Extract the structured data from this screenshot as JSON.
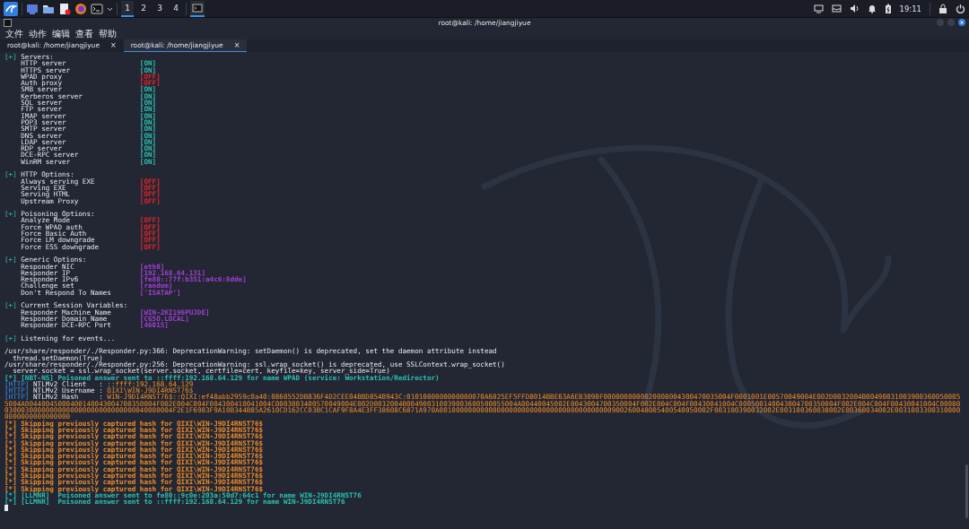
{
  "panel": {
    "workspaces": [
      {
        "label": "1",
        "selected": true
      },
      {
        "label": "2",
        "selected": false
      },
      {
        "label": "3",
        "selected": false
      },
      {
        "label": "4",
        "selected": false
      }
    ],
    "clock": "19:11"
  },
  "window": {
    "title": "root@kali: /home/jiangjiyue",
    "menu": [
      "文件",
      "动作",
      "编辑",
      "查看",
      "帮助"
    ],
    "tabs": [
      {
        "label": "root@kali: /home/jiangjiyue",
        "close": "×",
        "selected": false
      },
      {
        "label": "root@kali: /home/jiangjiyue",
        "close": "×",
        "selected": true
      }
    ]
  },
  "terminal": {
    "lines": [
      {
        "kind": "header",
        "bullet": "[+]",
        "text": "Servers:"
      },
      {
        "kind": "option",
        "label": "HTTP server",
        "value": "[ON]",
        "color": "#2bc0b4"
      },
      {
        "kind": "option",
        "label": "HTTPS server",
        "value": "[ON]",
        "color": "#2bc0b4"
      },
      {
        "kind": "option",
        "label": "WPAD proxy",
        "value": "[OFF]",
        "color": "#e0242a"
      },
      {
        "kind": "option",
        "label": "Auth proxy",
        "value": "[OFF]",
        "color": "#e0242a"
      },
      {
        "kind": "option",
        "label": "SMB server",
        "value": "[ON]",
        "color": "#2bc0b4"
      },
      {
        "kind": "option",
        "label": "Kerberos server",
        "value": "[ON]",
        "color": "#2bc0b4"
      },
      {
        "kind": "option",
        "label": "SQL server",
        "value": "[ON]",
        "color": "#2bc0b4"
      },
      {
        "kind": "option",
        "label": "FTP server",
        "value": "[ON]",
        "color": "#2bc0b4"
      },
      {
        "kind": "option",
        "label": "IMAP server",
        "value": "[ON]",
        "color": "#2bc0b4"
      },
      {
        "kind": "option",
        "label": "POP3 server",
        "value": "[ON]",
        "color": "#2bc0b4"
      },
      {
        "kind": "option",
        "label": "SMTP server",
        "value": "[ON]",
        "color": "#2bc0b4"
      },
      {
        "kind": "option",
        "label": "DNS server",
        "value": "[ON]",
        "color": "#2bc0b4"
      },
      {
        "kind": "option",
        "label": "LDAP server",
        "value": "[ON]",
        "color": "#2bc0b4"
      },
      {
        "kind": "option",
        "label": "RDP server",
        "value": "[ON]",
        "color": "#2bc0b4"
      },
      {
        "kind": "option",
        "label": "DCE-RPC server",
        "value": "[ON]",
        "color": "#2bc0b4"
      },
      {
        "kind": "option",
        "label": "WinRM server",
        "value": "[ON]",
        "color": "#2bc0b4"
      },
      {
        "kind": "blank"
      },
      {
        "kind": "header",
        "bullet": "[+]",
        "text": "HTTP Options:"
      },
      {
        "kind": "option",
        "label": "Always serving EXE",
        "value": "[OFF]",
        "color": "#e0242a"
      },
      {
        "kind": "option",
        "label": "Serving EXE",
        "value": "[OFF]",
        "color": "#e0242a"
      },
      {
        "kind": "option",
        "label": "Serving HTML",
        "value": "[OFF]",
        "color": "#e0242a"
      },
      {
        "kind": "option",
        "label": "Upstream Proxy",
        "value": "[OFF]",
        "color": "#e0242a"
      },
      {
        "kind": "blank"
      },
      {
        "kind": "header",
        "bullet": "[+]",
        "text": "Poisoning Options:"
      },
      {
        "kind": "option",
        "label": "Analyze Mode",
        "value": "[OFF]",
        "color": "#e0242a"
      },
      {
        "kind": "option",
        "label": "Force WPAD auth",
        "value": "[OFF]",
        "color": "#e0242a"
      },
      {
        "kind": "option",
        "label": "Force Basic Auth",
        "value": "[OFF]",
        "color": "#e0242a"
      },
      {
        "kind": "option",
        "label": "Force LM downgrade",
        "value": "[OFF]",
        "color": "#e0242a"
      },
      {
        "kind": "option",
        "label": "Force ESS downgrade",
        "value": "[OFF]",
        "color": "#e0242a"
      },
      {
        "kind": "blank"
      },
      {
        "kind": "header",
        "bullet": "[+]",
        "text": "Generic Options:"
      },
      {
        "kind": "option",
        "label": "Responder NIC",
        "value": "[eth0]",
        "color": "#a23fd6"
      },
      {
        "kind": "option",
        "label": "Responder IP",
        "value": "[192.168.64.131]",
        "color": "#a23fd6"
      },
      {
        "kind": "option",
        "label": "Responder IPv6",
        "value": "[fe80::77f:b351:a4c6:8dde]",
        "color": "#a23fd6"
      },
      {
        "kind": "option",
        "label": "Challenge set",
        "value": "[random]",
        "color": "#a23fd6"
      },
      {
        "kind": "option",
        "label": "Don't Respond To Names",
        "value": "['ISATAP']",
        "color": "#a23fd6"
      },
      {
        "kind": "blank"
      },
      {
        "kind": "header",
        "bullet": "[+]",
        "text": "Current Session Variables:"
      },
      {
        "kind": "option",
        "label": "Responder Machine Name",
        "value": "[WIN-2KI196PUJDE]",
        "color": "#a23fd6"
      },
      {
        "kind": "option",
        "label": "Responder Domain Name",
        "value": "[CG5O.LOCAL]",
        "color": "#a23fd6"
      },
      {
        "kind": "option",
        "label": "Responder DCE-RPC Port",
        "value": "[46015]",
        "color": "#a23fd6"
      },
      {
        "kind": "blank"
      },
      {
        "kind": "header",
        "bullet": "[+]",
        "text": "Listening for events..."
      },
      {
        "kind": "blank"
      },
      {
        "kind": "plain",
        "text": "/usr/share/responder/./Responder.py:366: DeprecationWarning: setDaemon() is deprecated, set the daemon attribute instead"
      },
      {
        "kind": "plain",
        "text": "  thread.setDaemon(True)"
      },
      {
        "kind": "plain",
        "text": "/usr/share/responder/./Responder.py:256: DeprecationWarning: ssl.wrap_socket() is deprecated, use SSLContext.wrap_socket()"
      },
      {
        "kind": "plain",
        "text": "  server.socket = ssl.wrap_socket(server.socket, certfile=cert, keyfile=key, server_side=True)"
      },
      {
        "kind": "message",
        "bullet": "[*]",
        "text": "[NBT-NS] Poisoned answer sent to ::ffff:192.168.64.129 for name WPAD (service: Workstation/Redirector)",
        "color": "#2bc0b4"
      },
      {
        "kind": "http",
        "tag": "[HTTP]",
        "label": "NTLMv2 Client   :",
        "value": "::ffff:192.168.64.129"
      },
      {
        "kind": "http",
        "tag": "[HTTP]",
        "label": "NTLMv2 Username :",
        "value": "QIXI\\WIN-J9DI4RNST76$"
      },
      {
        "kind": "http",
        "tag": "[HTTP]",
        "label": "NTLMv2 Hash     :",
        "value": "WIN-J9DI4RNST76$::QIXI:ef48abb2959c0a40:0860552DB836F4D2CEE04BBD854B943C:0101000000000000070A6025EF5FFD8014BBE63A6EB3090F0000000000020008004300470035004F0001001E00570049004E002D0032004B004900310039003600500055004A00440045000400140043004700350004F002E004C004F004300410041004C0003003400570049004E002D0032004B004900310039003600500055004A00440045002E0043004700350004F002E004C004F00430041004C000500140043004700350004F002E004C004F00430041004C0008003000300000000000000000000000000040000004F2E1F6983F9A10B344B85A2610CD162CC03BC1CAF9F8A4E3FF38608C6871A970A001000000000000000000000000000000000000000900260048005400540050002F003100390032002E003100360038002E00360034002E00310033003100000000000000000000"
      },
      {
        "kind": "message",
        "bullet": "[*]",
        "text": "Skipping previously captured hash for QIXI\\WIN-J9DI4RNST76$",
        "color": "#f08c28"
      },
      {
        "kind": "message",
        "bullet": "[*]",
        "text": "Skipping previously captured hash for QIXI\\WIN-J9DI4RNST76$",
        "color": "#f08c28"
      },
      {
        "kind": "message",
        "bullet": "[*]",
        "text": "Skipping previously captured hash for QIXI\\WIN-J9DI4RNST76$",
        "color": "#f08c28"
      },
      {
        "kind": "message",
        "bullet": "[*]",
        "text": "Skipping previously captured hash for QIXI\\WIN-J9DI4RNST76$",
        "color": "#f08c28"
      },
      {
        "kind": "message",
        "bullet": "[*]",
        "text": "Skipping previously captured hash for QIXI\\WIN-J9DI4RNST76$",
        "color": "#f08c28"
      },
      {
        "kind": "message",
        "bullet": "[*]",
        "text": "Skipping previously captured hash for QIXI\\WIN-J9DI4RNST76$",
        "color": "#f08c28"
      },
      {
        "kind": "message",
        "bullet": "[*]",
        "text": "Skipping previously captured hash for QIXI\\WIN-J9DI4RNST76$",
        "color": "#f08c28"
      },
      {
        "kind": "message",
        "bullet": "[*]",
        "text": "Skipping previously captured hash for QIXI\\WIN-J9DI4RNST76$",
        "color": "#f08c28"
      },
      {
        "kind": "message",
        "bullet": "[*]",
        "text": "Skipping previously captured hash for QIXI\\WIN-J9DI4RNST76$",
        "color": "#f08c28"
      },
      {
        "kind": "message",
        "bullet": "[*]",
        "text": "Skipping previously captured hash for QIXI\\WIN-J9DI4RNST76$",
        "color": "#f08c28"
      },
      {
        "kind": "message",
        "bullet": "[*]",
        "text": "Skipping previously captured hash for QIXI\\WIN-J9DI4RNST76$",
        "color": "#f08c28"
      },
      {
        "kind": "message",
        "bullet": "[*]",
        "text": "[LLMNR]  Poisoned answer sent to fe80::9c0e:203a:50d7:64c1 for name WIN-J9DI4RNST76",
        "color": "#2bc0b4"
      },
      {
        "kind": "message",
        "bullet": "[*]",
        "text": "[LLMNR]  Poisoned answer sent to ::ffff:192.168.64.129 for name WIN-J9DI4RNST76",
        "color": "#2bc0b4"
      }
    ]
  }
}
